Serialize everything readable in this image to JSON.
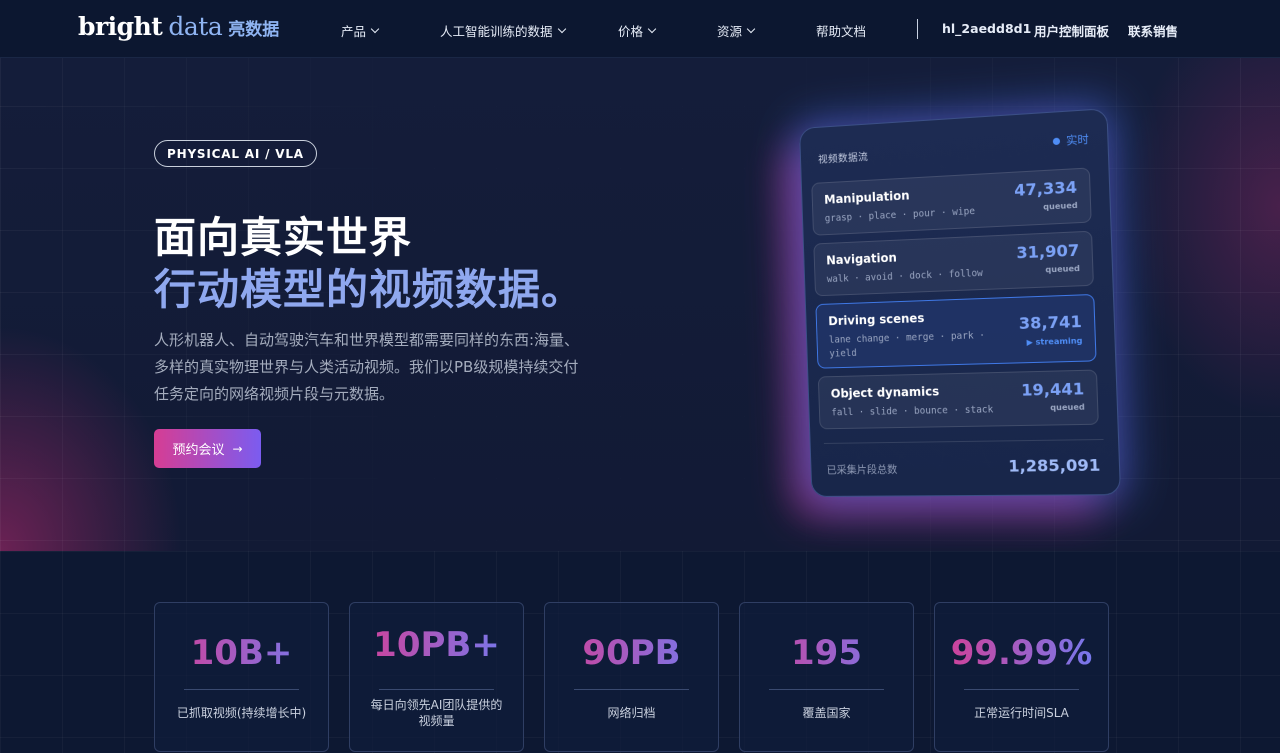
{
  "brand": {
    "word1": "bright",
    "word2": "data",
    "cn": "亮数据"
  },
  "nav": {
    "items": [
      {
        "label": "产品",
        "dropdown": true
      },
      {
        "label": "人工智能训练的数据",
        "dropdown": true
      },
      {
        "label": "价格",
        "dropdown": true
      },
      {
        "label": "资源",
        "dropdown": true
      },
      {
        "label": "帮助文档",
        "dropdown": false
      }
    ],
    "user": "hl_2aedd8d1",
    "dashboard": "用户控制面板",
    "contact": "联系销售"
  },
  "hero": {
    "badge": "PHYSICAL AI / VLA",
    "title_line1": "面向真实世界",
    "title_line2": "行动模型的视频数据。",
    "description": "人形机器人、自动驾驶汽车和世界模型都需要同样的东西:海量、多样的真实物理世界与人类活动视频。我们以PB级规模持续交付任务定向的网络视频片段与元数据。",
    "cta": "预约会议",
    "cta_icon": "arrow-right-icon"
  },
  "stream_card": {
    "title": "视频数据流",
    "live_label": "实时",
    "rows": [
      {
        "name": "Manipulation",
        "tags": "grasp · place · pour · wipe",
        "value": "47,334",
        "status": "queued"
      },
      {
        "name": "Navigation",
        "tags": "walk · avoid · dock · follow",
        "value": "31,907",
        "status": "queued"
      },
      {
        "name": "Driving scenes",
        "tags": "lane change · merge · park · yield",
        "value": "38,741",
        "status": "▶ streaming"
      },
      {
        "name": "Object dynamics",
        "tags": "fall · slide · bounce · stack",
        "value": "19,441",
        "status": "queued"
      }
    ],
    "total_label": "已采集片段总数",
    "total_value": "1,285,091"
  },
  "stats": [
    {
      "value": "10B+",
      "label": "已抓取视频(持续增长中)"
    },
    {
      "value": "10PB+",
      "label": "每日向领先AI团队提供的视频量"
    },
    {
      "value": "90PB",
      "label": "网络归档"
    },
    {
      "value": "195",
      "label": "覆盖国家"
    },
    {
      "value": "99.99%",
      "label": "正常运行时间SLA"
    }
  ],
  "colors": {
    "accent_pink": "#d63d93",
    "accent_blue": "#7b5cf0",
    "title_blue": "#8fa8ef",
    "live_blue": "#4f8df5"
  }
}
